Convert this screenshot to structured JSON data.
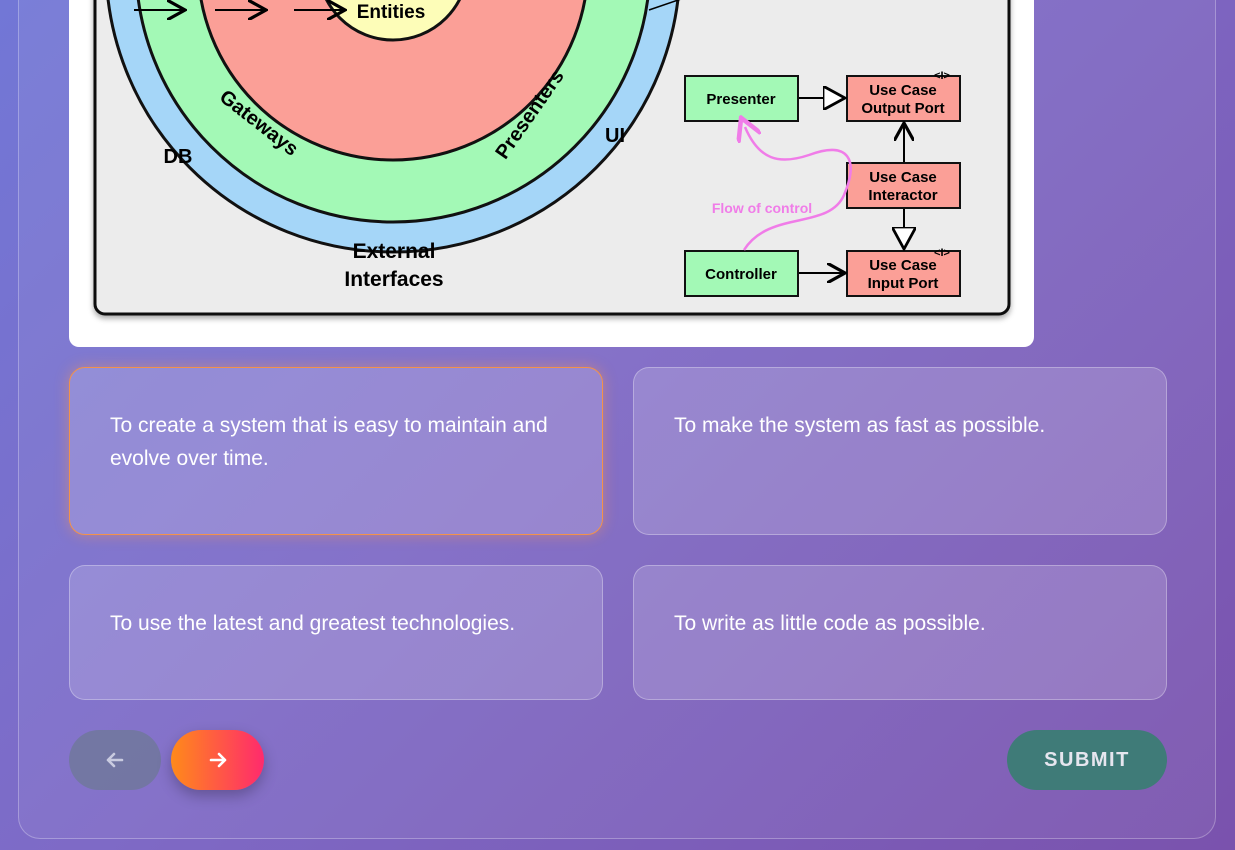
{
  "diagram": {
    "layers": {
      "entities": "Entities",
      "gateways": "Gateways",
      "presenters": "Presenters",
      "ui": "UI",
      "db": "DB",
      "external_line1": "External",
      "external_line2": "Interfaces"
    },
    "boxes": {
      "presenter": "Presenter",
      "controller": "Controller",
      "output_port_line1": "Use Case",
      "output_port_line2": "Output Port",
      "interactor_line1": "Use Case",
      "interactor_line2": "Interactor",
      "input_port_line1": "Use Case",
      "input_port_line2": "Input Port",
      "interface_marker": "<I>"
    },
    "flow_label": "Flow of control",
    "colors": {
      "entities": "#fdfdb8",
      "use_cases": "#fb9f97",
      "adapters": "#a3f9b6",
      "frameworks": "#a5d6f8",
      "flow": "#f07ce8"
    }
  },
  "options": [
    {
      "text": "To create a system that is easy to maintain and evolve over time.",
      "selected": true
    },
    {
      "text": "To make the system as fast as possible.",
      "selected": false
    },
    {
      "text": "To use the latest and greatest technologies.",
      "selected": false
    },
    {
      "text": "To write as little code as possible.",
      "selected": false
    }
  ],
  "nav": {
    "prev_icon": "arrow-left-icon",
    "next_icon": "arrow-right-icon",
    "submit_label": "SUBMIT"
  }
}
